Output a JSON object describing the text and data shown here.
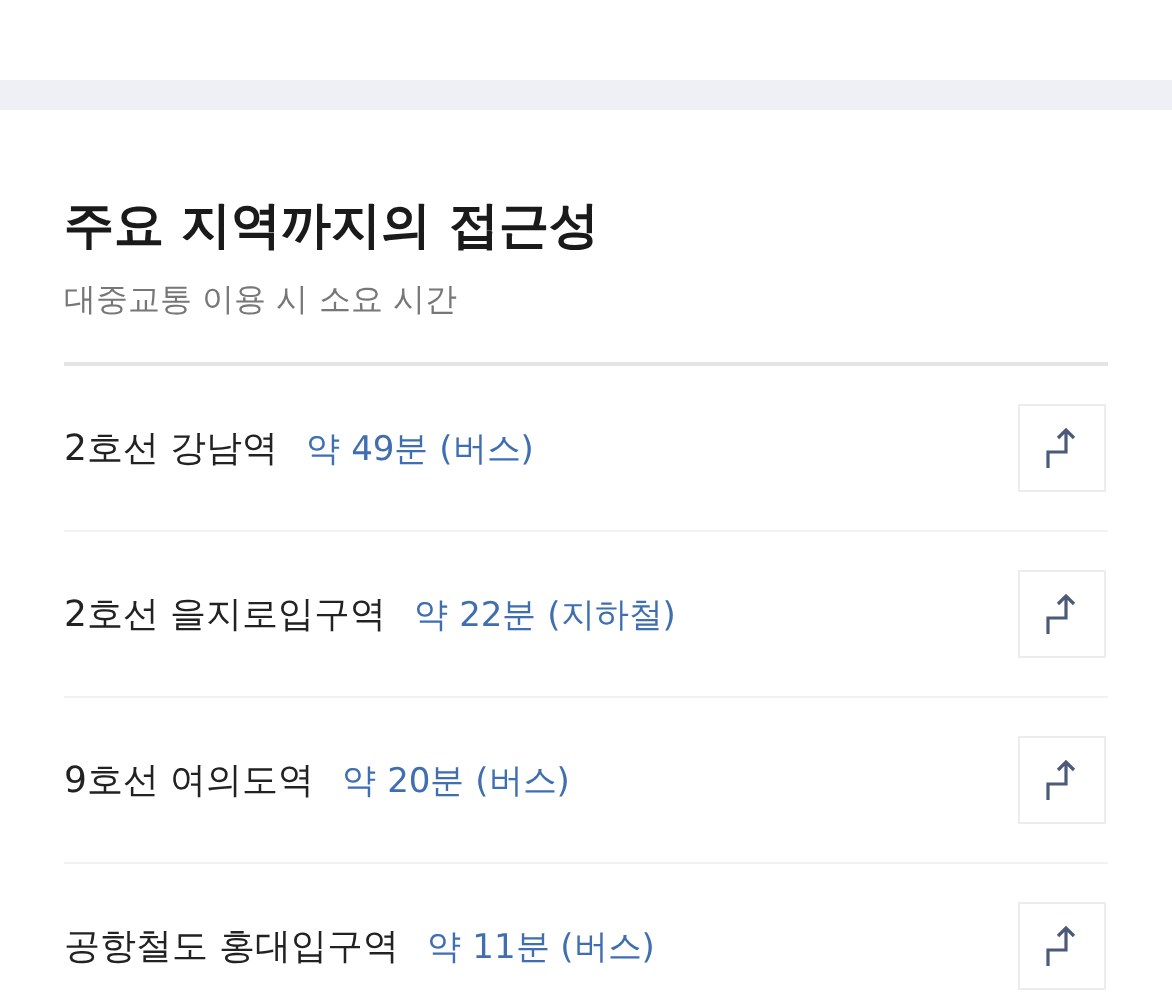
{
  "section": {
    "title": "주요 지역까지의 접근성",
    "subtitle": "대중교통 이용 시 소요 시간"
  },
  "destinations": [
    {
      "station": "2호선 강남역",
      "time": "약 49분 (버스)"
    },
    {
      "station": "2호선 을지로입구역",
      "time": "약 22분 (지하철)"
    },
    {
      "station": "9호선 여의도역",
      "time": "약 20분 (버스)"
    },
    {
      "station": "공항철도 홍대입구역",
      "time": "약 11분 (버스)"
    }
  ]
}
